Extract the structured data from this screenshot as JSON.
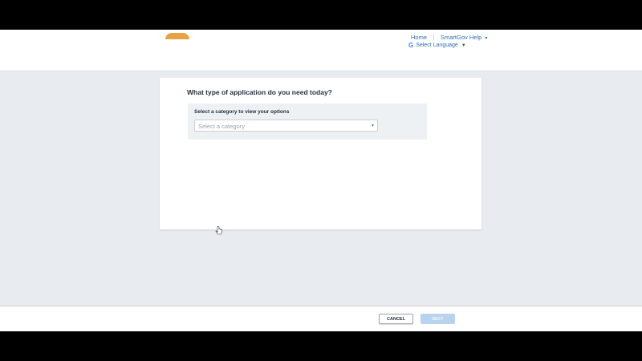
{
  "header": {
    "logo": "logo",
    "nav": {
      "home": "Home",
      "help": "SmartGov Help",
      "help_caret": "▾"
    },
    "language": {
      "icon": "google-icon",
      "label": "Select Language",
      "caret": "▼"
    }
  },
  "card": {
    "title": "What type of application do you need today?",
    "category_label": "Select a category to view your options",
    "select": {
      "placeholder": "Select a category",
      "caret": "▼"
    }
  },
  "footer": {
    "cancel_label": "CANCEL",
    "next_label": "NEXT"
  },
  "colors": {
    "link": "#2d6fb3",
    "page_bg": "#e8ecf0",
    "next_disabled": "#b9d2ee"
  }
}
